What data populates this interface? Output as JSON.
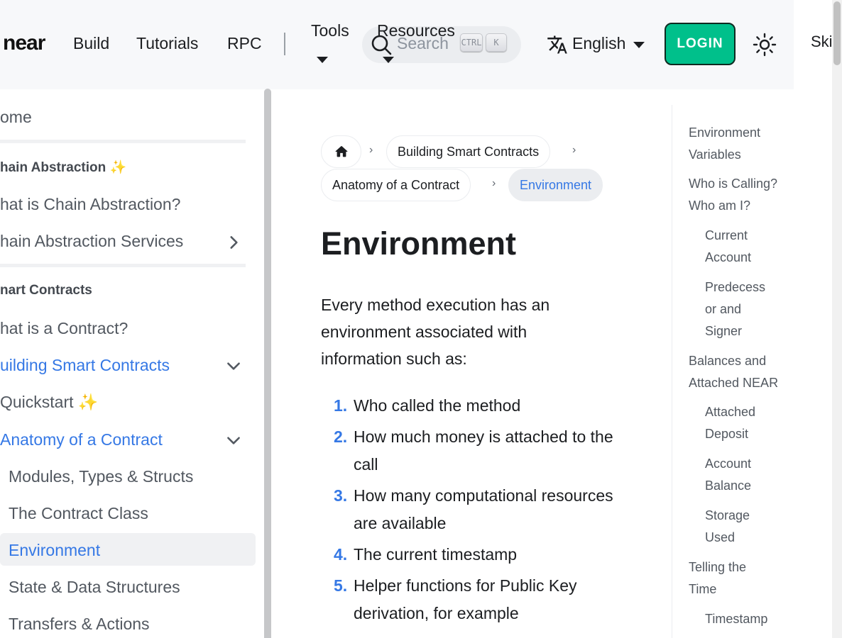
{
  "navbar": {
    "logo_text": "near",
    "links": [
      "Build",
      "Tutorials",
      "RPC"
    ],
    "tools_label": "Tools",
    "resources_label": "Resources",
    "search_placeholder": "Search",
    "search_kbd": [
      "CTRL",
      "K"
    ],
    "language": "English",
    "login_label": "LOGIN",
    "skip_link": "Skip to main content"
  },
  "sidebar": {
    "home": "ome",
    "cat_chain": "hain Abstraction ✨",
    "chain_items": [
      "hat is Chain Abstraction?",
      "hain Abstraction Services"
    ],
    "cat_smart": "nart Contracts",
    "what_contract": "hat is a Contract?",
    "building": "uilding Smart Contracts",
    "quickstart": "Quickstart ✨",
    "anatomy": "Anatomy of a Contract",
    "sub_items": [
      "Modules, Types & Structs",
      "The Contract Class",
      "Environment",
      "State & Data Structures",
      "Transfers & Actions"
    ]
  },
  "breadcrumbs": [
    "Building Smart Contracts",
    "Anatomy of a Contract",
    "Environment"
  ],
  "main": {
    "title": "Environment",
    "intro": "Every method execution has an environment associated with information such as:",
    "list": [
      "Who called the method",
      "How much money is attached to the call",
      "How many computational resources are available",
      "The current timestamp",
      "Helper functions for Public Key derivation, for example"
    ]
  },
  "toc": [
    "Environment Variables",
    "Who is Calling? Who am I?",
    "Current Account",
    "Predecessor and Signer",
    "Balances and Attached NEAR",
    "Attached Deposit",
    "Account Balance",
    "Storage Used",
    "Telling the Time",
    "Timestamp"
  ],
  "toc_display": [
    [
      "Environment",
      "Variables"
    ],
    [
      "Who is Calling?",
      "Who am I?"
    ],
    [
      "Current",
      "Account"
    ],
    [
      "Predecess",
      "or and",
      "Signer"
    ],
    [
      "Balances and",
      "Attached NEAR"
    ],
    [
      "Attached",
      "Deposit"
    ],
    [
      "Account",
      "Balance"
    ],
    [
      "Storage",
      "Used"
    ],
    [
      "Telling the",
      "Time"
    ],
    [
      "Timestamp"
    ]
  ],
  "colors": {
    "accent": "#3578e5",
    "login": "#00c08b",
    "navbar_bg": "#f7f8fa"
  }
}
